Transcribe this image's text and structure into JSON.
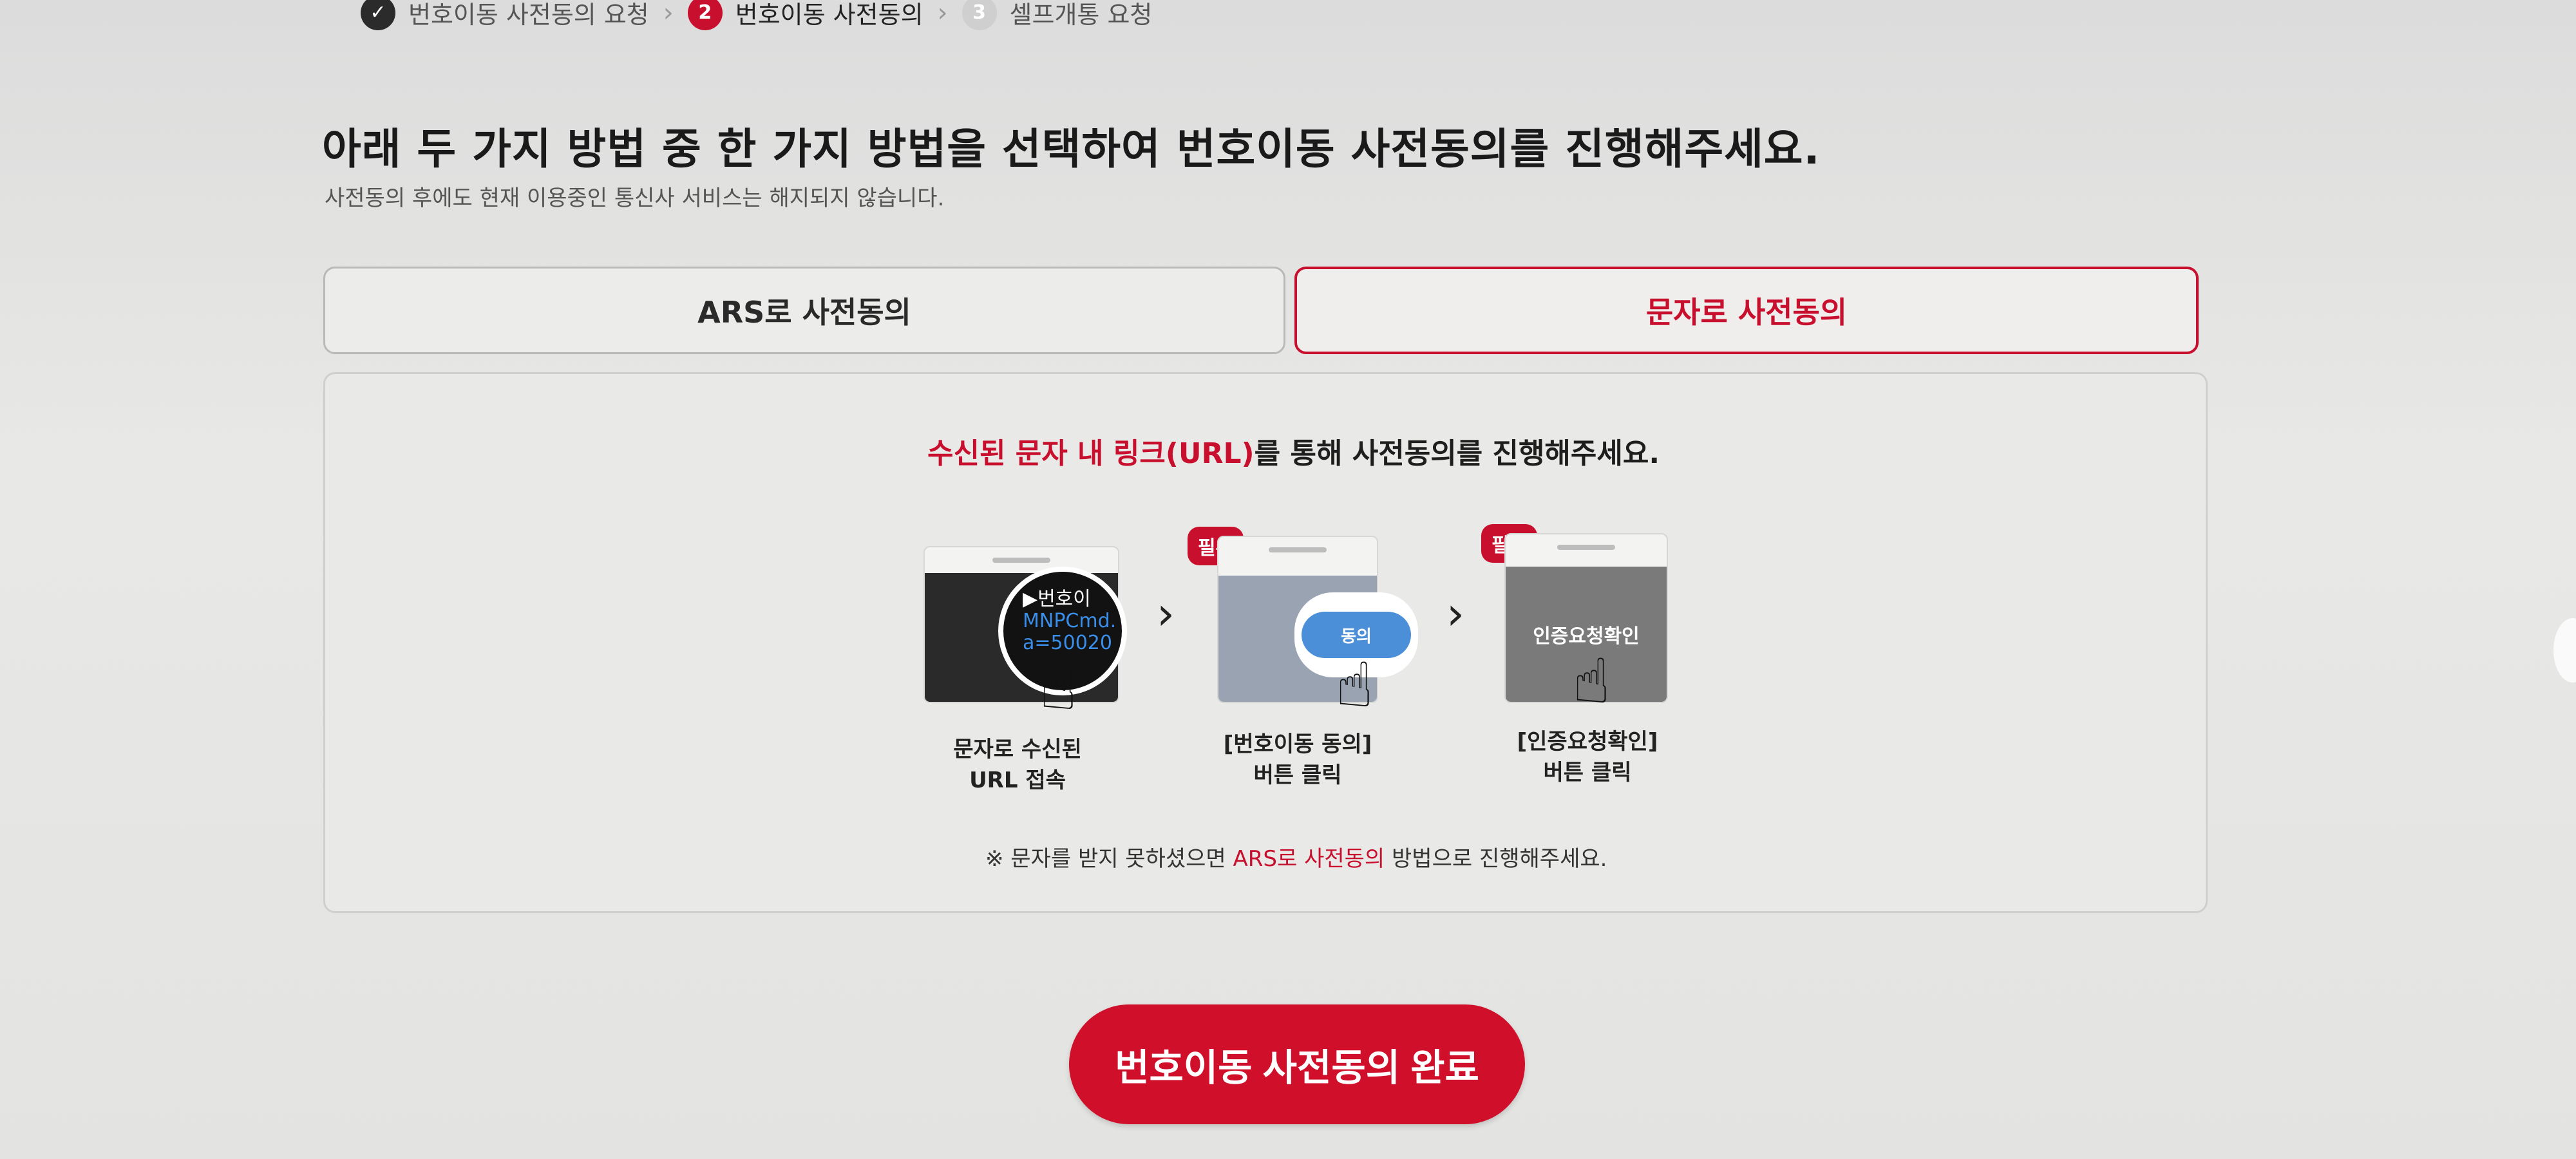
{
  "stepper": {
    "steps": [
      {
        "number": "✓",
        "label": "번호이동 사전동의 요청"
      },
      {
        "number": "2",
        "label": "번호이동 사전동의"
      },
      {
        "number": "3",
        "label": "셀프개통 요청"
      }
    ]
  },
  "header": {
    "title": "아래 두 가지 방법 중 한 가지 방법을 선택하여 번호이동 사전동의를 진행해주세요.",
    "subtitle": "사전동의 후에도 현재 이용중인 통신사 서비스는 해지되지 않습니다."
  },
  "tabs": [
    {
      "label": "ARS로 사전동의",
      "selected": false
    },
    {
      "label": "문자로 사전동의",
      "selected": true
    }
  ],
  "instruction": {
    "highlight": "수신된 문자 내 링크(URL)",
    "rest": "를 통해 사전동의를 진행해주세요."
  },
  "steps_guide": [
    {
      "badge": "",
      "bubble_lines": [
        "▶번호이",
        "MNPCmd.",
        "a=50020"
      ],
      "caption_line1": "문자로 수신된",
      "caption_line2": "URL 접속"
    },
    {
      "badge": "필수",
      "button_text": "동의",
      "caption_line1": "[번호이동 동의]",
      "caption_line2": "버튼 클릭"
    },
    {
      "badge": "필수",
      "button_text": "인증요청확인",
      "caption_line1": "[인증요청확인]",
      "caption_line2": "버튼 클릭"
    }
  ],
  "notice": {
    "prefix": "※ 문자를 받지 못하셨으면 ",
    "highlight": "ARS로 사전동의",
    "suffix": " 방법으로 진행해주세요."
  },
  "complete_button": {
    "label": "번호이동 사전동의 완료"
  },
  "colors": {
    "accent": "#c8102e",
    "text": "#1e1e1e",
    "muted": "#555555"
  }
}
